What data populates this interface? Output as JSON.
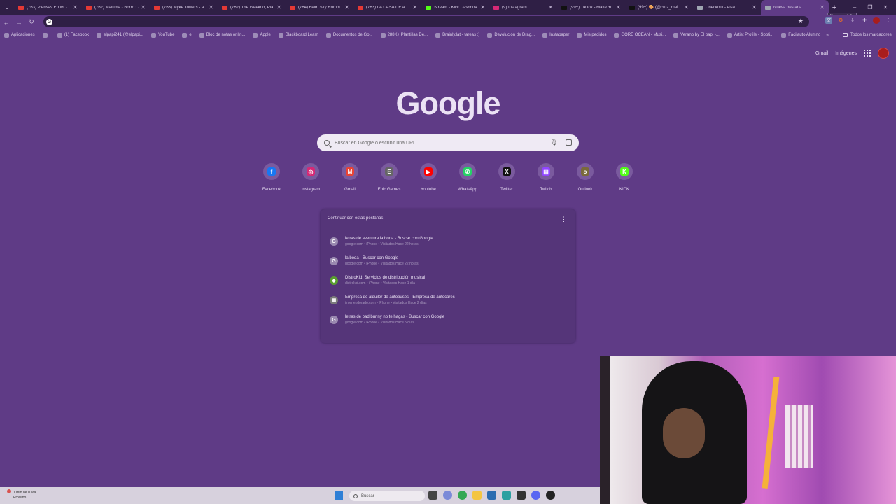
{
  "browser": {
    "tabs": [
      {
        "title": "(763) Piensas En Mi - ",
        "color": "#e53935"
      },
      {
        "title": "(762) Maluma - Borro C",
        "color": "#e53935"
      },
      {
        "title": "(763) Myke Towers - A",
        "color": "#e53935"
      },
      {
        "title": "(762) The Weeknd, Pla",
        "color": "#e53935"
      },
      {
        "title": "(764) Feid, Sky Rompi",
        "color": "#e53935"
      },
      {
        "title": "(763) LA CASA DE ALO",
        "color": "#e53935"
      },
      {
        "title": "Stream - Kick Dashboa",
        "color": "#53fc18"
      },
      {
        "title": "(9) Instagram",
        "color": "#d62976"
      },
      {
        "title": "(99+) TikTok - Make Yo",
        "color": "#111111"
      },
      {
        "title": "(99+) 🎨 (@cruz_mal",
        "color": "#111111"
      },
      {
        "title": "Checkout - Alsa",
        "color": "#9fa6b2"
      },
      {
        "title": "Nueva pestaña",
        "color": "#9fa6b2"
      }
    ],
    "active_tab_index": 11,
    "new_tab_tooltip": "Nueva pestaña"
  },
  "omnibox": {
    "value": ""
  },
  "bookmarks": {
    "items": [
      "Aplicaciones",
      "",
      "(1) Facebook",
      "elpapi241 (@elpapi...",
      "YouTube",
      "e",
      "Bloc de notas onlin...",
      "Apple",
      "Blackboard Learn",
      "Documentos de Go...",
      "288K+ Plantillas De...",
      "Brainly.lat - tareas :)",
      "Devolución de Drag...",
      "Instapaper",
      "Mis pedidos",
      "GORE OCEAN - Musi...",
      "Verano by El papi -...",
      "Artist Profile - Spoti...",
      "Facilauto Alumno"
    ],
    "more": "»",
    "all_bookmarks": "Todos los marcadores"
  },
  "header": {
    "gmail": "Gmail",
    "images": "Imágenes"
  },
  "logo": "Google",
  "search": {
    "placeholder": "Buscar en Google o escribir una URL"
  },
  "shortcuts": [
    {
      "label": "Facebook",
      "icon": "facebook-icon",
      "color": "#1877f2",
      "glyph": "f"
    },
    {
      "label": "Instagram",
      "icon": "instagram-icon",
      "color": "#d62976",
      "glyph": "◎"
    },
    {
      "label": "Gmail",
      "icon": "gmail-icon",
      "color": "#ea4335",
      "glyph": "M"
    },
    {
      "label": "Epic Games",
      "icon": "epic-games-icon",
      "color": "#666666",
      "glyph": "E"
    },
    {
      "label": "Youtube",
      "icon": "youtube-icon",
      "color": "#ff0000",
      "glyph": "▶"
    },
    {
      "label": "WhatsApp",
      "icon": "whatsapp-icon",
      "color": "#25d366",
      "glyph": "✆"
    },
    {
      "label": "Twitter",
      "icon": "x-twitter-icon",
      "color": "#111111",
      "glyph": "X"
    },
    {
      "label": "Twitch",
      "icon": "twitch-icon",
      "color": "#9146ff",
      "glyph": "▤"
    },
    {
      "label": "Outlook",
      "icon": "outlook-icon",
      "color": "#7a6a3a",
      "glyph": "o"
    },
    {
      "label": "KICK",
      "icon": "kick-icon",
      "color": "#53fc18",
      "glyph": "K"
    }
  ],
  "continue_card": {
    "title": "Continuar con estas pestañas",
    "items": [
      {
        "title": "letras de aventura la boda - Buscar con Google",
        "sub": "google.com • iPhone • Visitados Hace 22 horas",
        "icon": "google-icon"
      },
      {
        "title": "la boda - Buscar con Google",
        "sub": "google.com • iPhone • Visitados Hace 22 horas",
        "icon": "google-icon"
      },
      {
        "title": "DistroKid: Servicios de distribución musical",
        "sub": "distrokid.com • iPhone • Visitados Hace 1 día",
        "icon": "distrokid-icon"
      },
      {
        "title": "Empresa de alquiler de autobuses - Empresa de autocares",
        "sub": "jimenezdorado.com • iPhone • Visitados Hace 2 días",
        "icon": "bus-company-icon"
      },
      {
        "title": "letras de bad bunny no te hagas - Buscar con Google",
        "sub": "google.com • iPhone • Visitados Hace 5 días",
        "icon": "google-icon"
      }
    ]
  },
  "taskbar": {
    "weather_line1": "1 mm de lluvia",
    "weather_line2": "Próximo",
    "search_placeholder": "Buscar"
  }
}
